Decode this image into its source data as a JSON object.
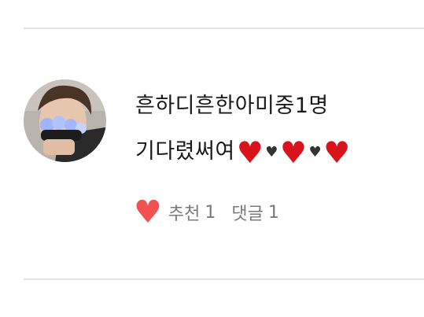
{
  "comment": {
    "line1": "흔하디흔한아미중1명",
    "line2": "기다렸써여"
  },
  "emoji": {
    "big_heart": "♥",
    "small_heart": "♥",
    "big_heart_color": "#d8131c",
    "small_heart_color": "#333333"
  },
  "actions": {
    "like_icon": "♥",
    "like_label": "추천",
    "like_count": "1",
    "reply_label": "댓글",
    "reply_count": "1",
    "like_icon_color": "#f25151"
  }
}
